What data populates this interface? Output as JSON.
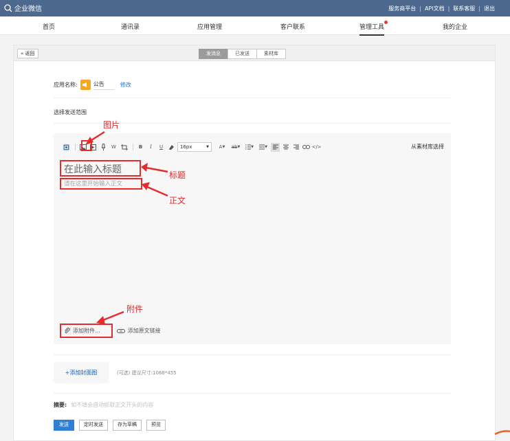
{
  "topbar": {
    "logo_text": "企业微信",
    "links": [
      "服务商平台",
      "API文档",
      "联系客服",
      "退出"
    ]
  },
  "nav": {
    "items": [
      {
        "label": "首页",
        "active": false
      },
      {
        "label": "通讯录",
        "active": false
      },
      {
        "label": "应用管理",
        "active": false
      },
      {
        "label": "客户联系",
        "active": false
      },
      {
        "label": "管理工具",
        "active": true,
        "badge": true
      },
      {
        "label": "我的企业",
        "active": false
      }
    ]
  },
  "subbar": {
    "back_label": "« 返回",
    "tabs": [
      {
        "label": "发消息",
        "active": true
      },
      {
        "label": "已发送",
        "active": false
      },
      {
        "label": "素材库",
        "active": false
      }
    ]
  },
  "form": {
    "app_name_label": "应用名称:",
    "app_name": "公告",
    "edit_label": "修改",
    "range_label": "选择发送范围"
  },
  "editor": {
    "font_size": "16px",
    "material_link": "从素材库选择",
    "title_placeholder": "在此输入标题",
    "body_placeholder": "请在这里开始输入正文",
    "attach_label": "添加附件...",
    "link_label": "添加原文链接",
    "toolbar_icons": [
      "image-icon",
      "video-icon",
      "voice-icon",
      "word-icon",
      "crop-icon",
      "bold-icon",
      "italic-icon",
      "underline-icon",
      "eraser-icon",
      "font-color-icon",
      "strikethrough-icon",
      "list-icon",
      "align-icon",
      "align-left-icon",
      "align-center-icon",
      "align-right-icon",
      "link-icon",
      "code-icon"
    ]
  },
  "cover": {
    "button_label": "+添加封面图",
    "hint": "(可选)  建议尺寸:1068*455"
  },
  "summary": {
    "label": "摘要:",
    "placeholder": "如不填会自动抓取正文开头的内容"
  },
  "actions": {
    "send": "发送",
    "schedule": "定时发送",
    "draft": "存为草稿",
    "preview": "预览"
  },
  "annotations": {
    "image_label": "图片",
    "title_label": "标题",
    "body_label": "正文",
    "attach_label": "附件"
  },
  "colors": {
    "topbar": "#4d6a8e",
    "primary": "#2f80d5",
    "annotation": "#e52b2b",
    "app_icon": "#f6a623"
  }
}
